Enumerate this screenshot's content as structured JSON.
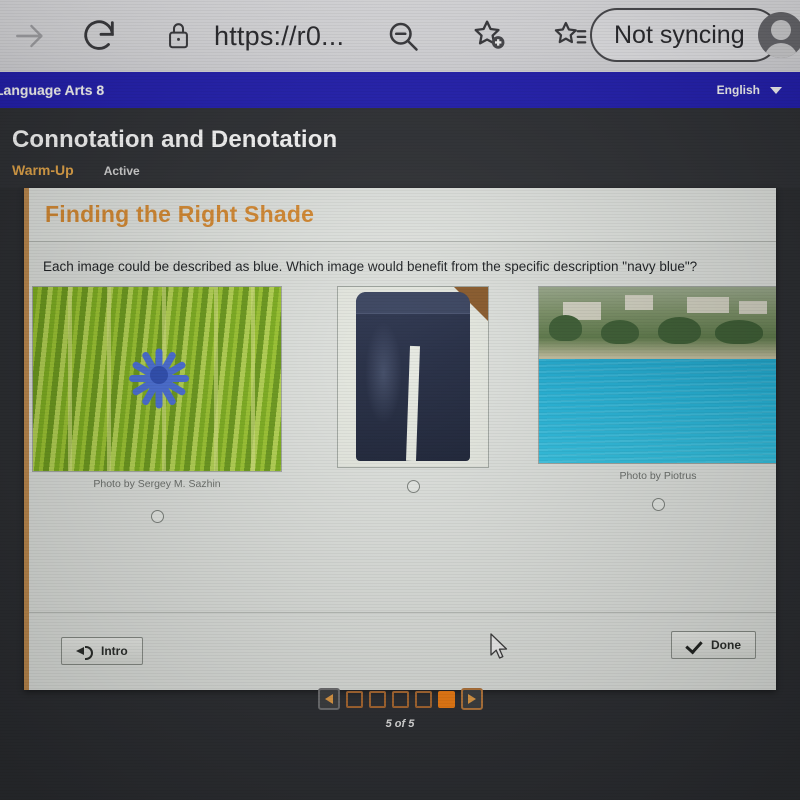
{
  "browser": {
    "icons": [
      "forward-arrow-icon",
      "reload-icon",
      "lock-icon",
      "zoom-out-icon",
      "add-bookmark-icon",
      "collections-icon"
    ],
    "url": "https://r0...",
    "sync_status": "Not syncing"
  },
  "course_bar": {
    "course_name": "Language Arts 8",
    "language": "English"
  },
  "lesson": {
    "title": "Connotation and Denotation",
    "section": "Warm-Up",
    "status": "Active"
  },
  "card": {
    "title": "Finding the Right Shade",
    "question": "Each image could be described as blue. Which image would benefit from the specific description \"navy blue\"?",
    "options": [
      {
        "id": "option-flower",
        "credit": "Photo by Sergey M. Sazhin",
        "alt": "blue cornflower in green grass",
        "selected": false
      },
      {
        "id": "option-jeans",
        "credit": "",
        "alt": "dark navy blue jeans",
        "selected": false
      },
      {
        "id": "option-sea",
        "credit": "Photo by Piotrus",
        "alt": "turquoise sea and coastline",
        "selected": false
      }
    ],
    "intro_label": "Intro",
    "done_label": "Done"
  },
  "pager": {
    "prev_label": "Previous",
    "next_label": "Next",
    "total": 5,
    "current": 5,
    "label": "5 of 5"
  },
  "colors": {
    "course_bar": "#2420b4",
    "card_title": "#d98c32",
    "section_label": "#e9a94a",
    "pager_current": "#f07c10",
    "card_accent_border": "#c08b4e"
  }
}
